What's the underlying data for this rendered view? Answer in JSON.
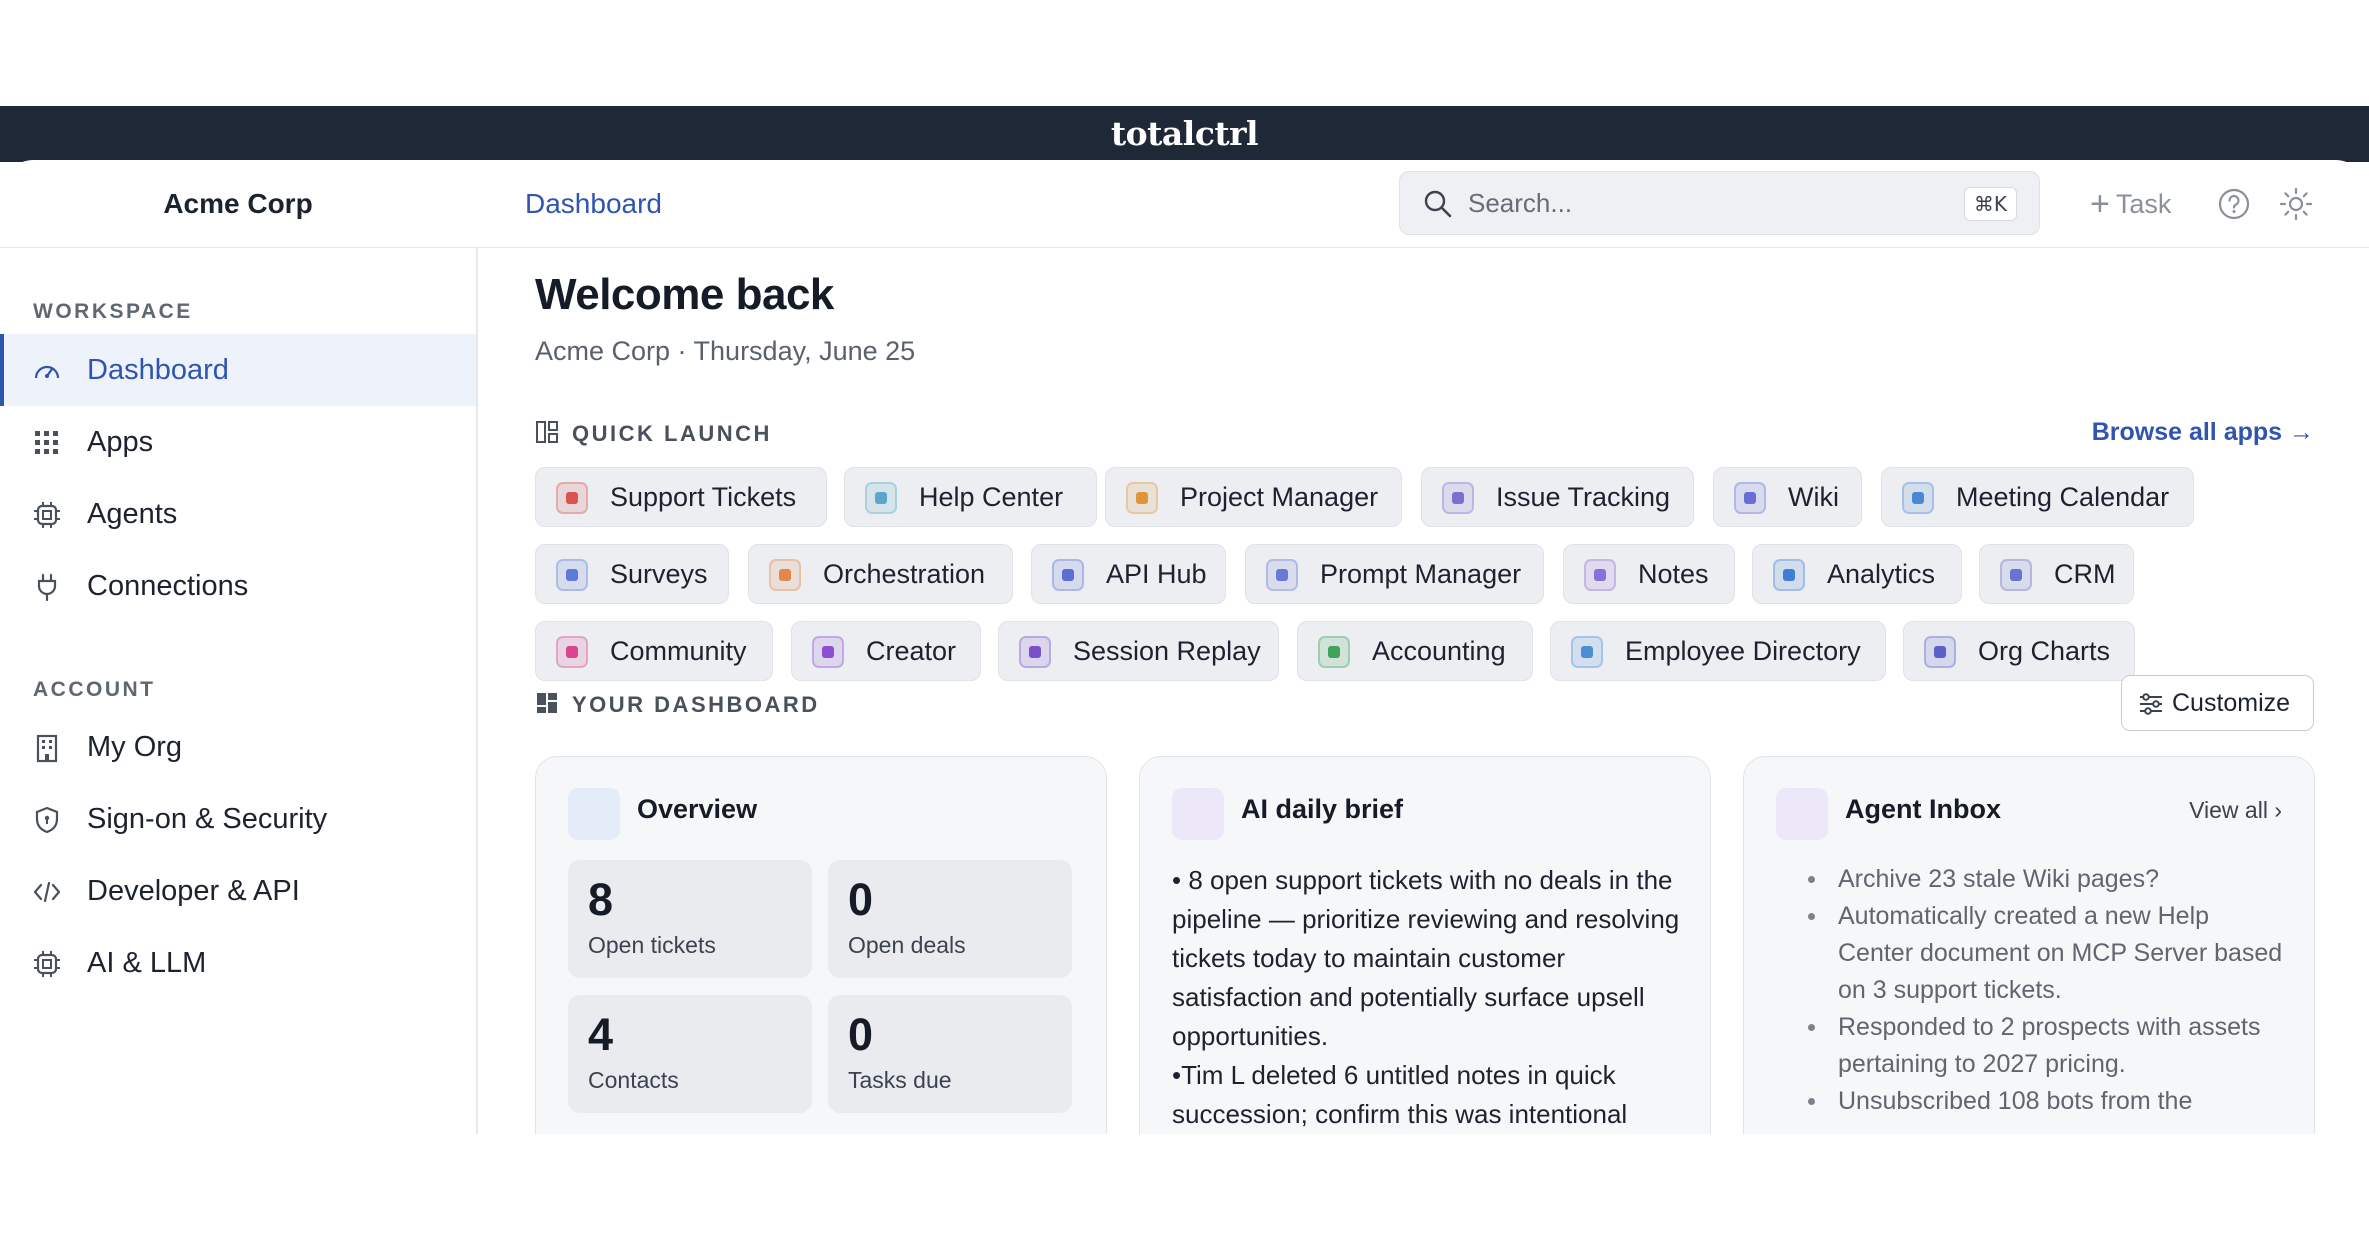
{
  "brand": "totalctrl",
  "header": {
    "org_name": "Acme Corp",
    "breadcrumb": "Dashboard",
    "search_placeholder": "Search...",
    "search_shortcut": "⌘K",
    "task_label": "Task"
  },
  "sidebar": {
    "workspace_heading": "WORKSPACE",
    "workspace_items": [
      {
        "label": "Dashboard",
        "icon": "gauge-icon",
        "active": true
      },
      {
        "label": "Apps",
        "icon": "grid-icon"
      },
      {
        "label": "Agents",
        "icon": "chip-icon"
      },
      {
        "label": "Connections",
        "icon": "plug-icon"
      }
    ],
    "account_heading": "ACCOUNT",
    "account_items": [
      {
        "label": "My Org",
        "icon": "building-icon"
      },
      {
        "label": "Sign-on & Security",
        "icon": "shield-icon"
      },
      {
        "label": "Developer & API",
        "icon": "code-icon"
      },
      {
        "label": "AI & LLM",
        "icon": "chip-icon"
      }
    ]
  },
  "main": {
    "title": "Welcome back",
    "subtitle": "Acme Corp · Thursday, June 25",
    "quick_launch_heading": "QUICK LAUNCH",
    "browse_link": "Browse all apps →",
    "apps": [
      {
        "label": "Support Tickets",
        "color": "#d9534f"
      },
      {
        "label": "Help Center",
        "color": "#5aa7c9"
      },
      {
        "label": "Project Manager",
        "color": "#e0953a"
      },
      {
        "label": "Issue Tracking",
        "color": "#7b6fd1"
      },
      {
        "label": "Wiki",
        "color": "#6a6fd6"
      },
      {
        "label": "Meeting Calendar",
        "color": "#4a88d6"
      },
      {
        "label": "Surveys",
        "color": "#5b7bd6"
      },
      {
        "label": "Orchestration",
        "color": "#e3874a"
      },
      {
        "label": "API Hub",
        "color": "#5a6fd6"
      },
      {
        "label": "Prompt Manager",
        "color": "#6a78d6"
      },
      {
        "label": "Notes",
        "color": "#8a6fd6"
      },
      {
        "label": "Analytics",
        "color": "#3f7fd6"
      },
      {
        "label": "CRM",
        "color": "#6a72c9"
      },
      {
        "label": "Community",
        "color": "#d9468f"
      },
      {
        "label": "Creator",
        "color": "#8a4fd1"
      },
      {
        "label": "Session Replay",
        "color": "#7a4fc9"
      },
      {
        "label": "Accounting",
        "color": "#3fa35a"
      },
      {
        "label": "Employee Directory",
        "color": "#4a8fd6"
      },
      {
        "label": "Org Charts",
        "color": "#5a5fc9"
      }
    ],
    "dashboard_heading": "YOUR DASHBOARD",
    "customize_label": "Customize",
    "overview": {
      "title": "Overview",
      "stats": [
        {
          "value": "8",
          "label": "Open tickets"
        },
        {
          "value": "0",
          "label": "Open deals"
        },
        {
          "value": "4",
          "label": "Contacts"
        },
        {
          "value": "0",
          "label": "Tasks due"
        }
      ]
    },
    "brief": {
      "title": "AI daily brief",
      "paragraphs": [
        "• 8 open support tickets with no deals in the pipeline — prioritize reviewing and resolving tickets today to maintain customer satisfaction and potentially surface upsell opportunities.",
        "•Tim L deleted 6 untitled notes in quick succession; confirm this was intentional"
      ]
    },
    "inbox": {
      "title": "Agent Inbox",
      "view_all": "View all ›",
      "items": [
        "Archive 23 stale Wiki pages?",
        "Automatically created a new Help Center document on MCP Server based on 3 support tickets.",
        "Responded to 2 prospects with assets pertaining to 2027 pricing.",
        "Unsubscribed 108 bots from the"
      ]
    }
  }
}
